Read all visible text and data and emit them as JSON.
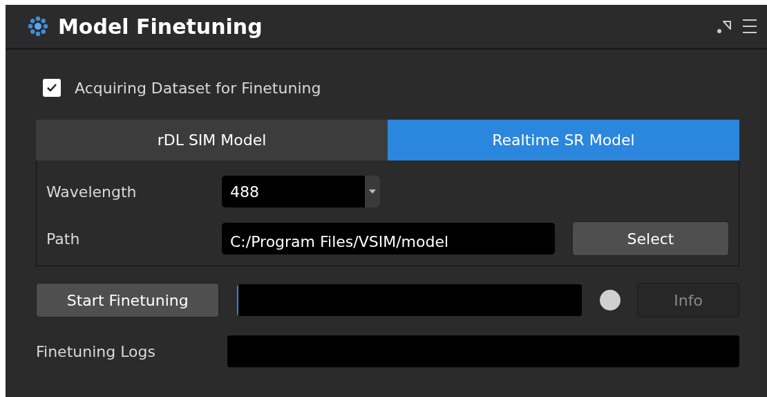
{
  "window": {
    "title": "Model Finetuning"
  },
  "acquire_checkbox": {
    "label": "Acquiring Dataset for Finetuning",
    "checked": true
  },
  "tabs": [
    {
      "label": "rDL SIM Model",
      "selected": false
    },
    {
      "label": "Realtime SR Model",
      "selected": true
    }
  ],
  "wavelength": {
    "label": "Wavelength",
    "value": "488"
  },
  "path": {
    "label": "Path",
    "value": "C:/Program Files/VSIM/model",
    "button": "Select"
  },
  "start_button": "Start Finetuning",
  "progress": {
    "level": 0.003
  },
  "status_dot": {
    "color": "#d0d0d0"
  },
  "info_button": {
    "label": "Info",
    "disabled": true
  },
  "logs": {
    "label": "Finetuning Logs"
  }
}
